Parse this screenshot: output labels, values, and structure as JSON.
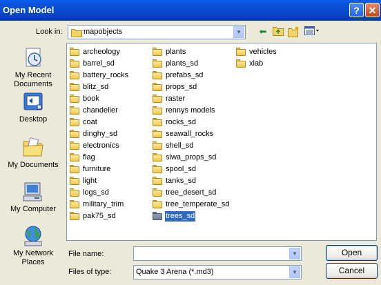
{
  "window": {
    "title": "Open Model",
    "help_glyph": "?",
    "close_glyph": "✕"
  },
  "lookin": {
    "label": "Look in:",
    "value": "mapobjects"
  },
  "places": [
    {
      "label_1": "My Recent",
      "label_2": "Documents"
    },
    {
      "label_1": "Desktop",
      "label_2": ""
    },
    {
      "label_1": "My Documents",
      "label_2": ""
    },
    {
      "label_1": "My Computer",
      "label_2": ""
    },
    {
      "label_1": "My Network",
      "label_2": "Places"
    }
  ],
  "files": {
    "col1": [
      "archeology",
      "barrel_sd",
      "battery_rocks",
      "blitz_sd",
      "book",
      "chandelier",
      "coat",
      "dinghy_sd",
      "electronics",
      "flag",
      "furniture",
      "light",
      "logs_sd",
      "military_trim",
      "pak75_sd"
    ],
    "col2": [
      "plants",
      "plants_sd",
      "prefabs_sd",
      "props_sd",
      "raster",
      "rennys models",
      "rocks_sd",
      "seawall_rocks",
      "shell_sd",
      "siwa_props_sd",
      "spool_sd",
      "tanks_sd",
      "tree_desert_sd",
      "tree_temperate_sd",
      "trees_sd"
    ],
    "col3": [
      "vehicles",
      "xlab"
    ],
    "selected": "trees_sd"
  },
  "filename": {
    "label": "File name:",
    "value": ""
  },
  "filetype": {
    "label": "Files of type:",
    "value": "Quake 3 Arena (*.md3)"
  },
  "buttons": {
    "open": "Open",
    "cancel": "Cancel"
  },
  "colors": {
    "titlebar": "#0846c6",
    "selection": "#316ac5",
    "dialog_bg": "#ece9d8"
  }
}
